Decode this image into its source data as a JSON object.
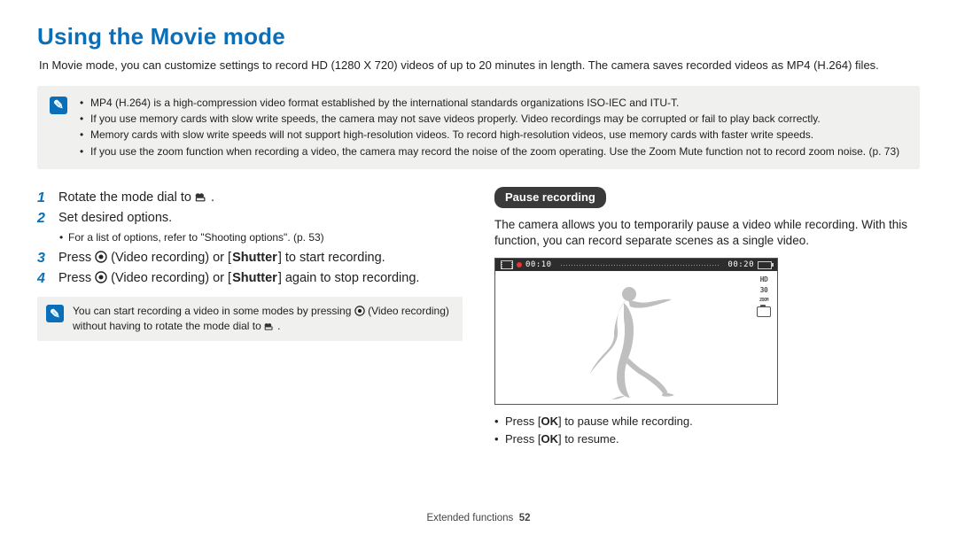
{
  "title": "Using the Movie mode",
  "intro": "In Movie mode, you can customize settings to record HD (1280 X 720) videos of up to 20 minutes in length. The camera saves recorded videos as MP4 (H.264) files.",
  "note_box": {
    "items": [
      "MP4 (H.264) is a high-compression video format established by the international standards organizations ISO-IEC and ITU-T.",
      "If you use memory cards with slow write speeds, the camera may not save videos properly. Video recordings may be corrupted or fail to play back correctly.",
      "Memory cards with slow write speeds will not support high-resolution videos. To record high-resolution videos, use memory cards with faster write speeds.",
      "If you use the zoom function when recording a video, the camera may record the noise of the zoom operating. Use the Zoom Mute function not to record zoom noise. (p. 73)"
    ]
  },
  "steps": {
    "s1_a": "Rotate the mode dial to ",
    "s1_b": ".",
    "s2": "Set desired options.",
    "s2_note": "For a list of options, refer to \"Shooting options\". (p. 53)",
    "s3_a": "Press ",
    "s3_b": " (Video recording) or [",
    "s3_shutter": "Shutter",
    "s3_c": "] to start recording.",
    "s4_a": "Press ",
    "s4_b": " (Video recording) or [",
    "s4_shutter": "Shutter",
    "s4_c": "] again to stop recording."
  },
  "steps_nums": {
    "n1": "1",
    "n2": "2",
    "n3": "3",
    "n4": "4"
  },
  "small_note_a": "You can start recording a video in some modes by pressing ",
  "small_note_b": " (Video recording) without having to rotate the mode dial to ",
  "small_note_c": ".",
  "right": {
    "pill": "Pause recording",
    "desc": "The camera allows you to temporarily pause a video while recording. With this function, you can record separate scenes as a single video.",
    "pause_a": "Press [",
    "ok": "OK",
    "pause_b": "] to pause while recording.",
    "resume_a": "Press [",
    "resume_b": "] to resume."
  },
  "preview": {
    "rec_time": "00:10",
    "total_time": "00:20",
    "hd": "HD",
    "fps": "30",
    "zoom": "ZOOM"
  },
  "footer": {
    "section": "Extended functions",
    "page": "52"
  }
}
